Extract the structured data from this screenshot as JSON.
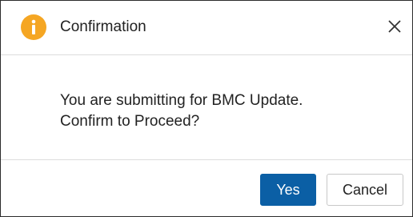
{
  "dialog": {
    "title": "Confirmation",
    "title_icon": "info-icon",
    "close_icon": "close-icon",
    "message_line1": "You are submitting for BMC Update.",
    "message_line2": "Confirm to Proceed?"
  },
  "buttons": {
    "yes_label": "Yes",
    "cancel_label": "Cancel"
  },
  "colors": {
    "icon_orange": "#f5a623",
    "primary_blue": "#0b5fa5"
  }
}
